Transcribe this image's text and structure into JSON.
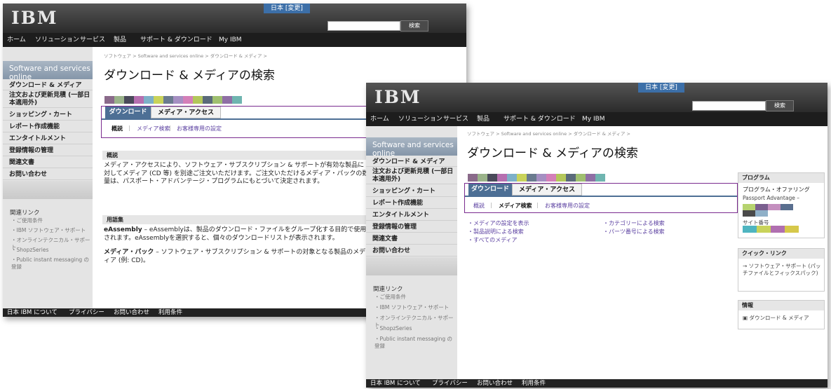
{
  "common": {
    "logo": "IBM",
    "country": "日本 [変更]",
    "search_button": "検索",
    "nav": [
      "ホーム",
      "ソリューション",
      "サービス",
      "製品",
      "サポート & ダウンロード",
      "My IBM"
    ],
    "side_header": "Software and services online",
    "side_items": [
      "ダウンロード & メディア",
      "注文および更新見積 (一部日本適用外)",
      "ショッピング・カート",
      "レポート作成機能",
      "エンタイトルメント",
      "登録情報の管理",
      "関連文書",
      "お問い合わせ"
    ],
    "related_title": "関連リンク",
    "related_items": [
      "ご使用条件",
      "IBM ソフトウェア・サポート",
      "オンラインテクニカル・サポート",
      "ShopzSeries",
      "Public instant messaging の登録"
    ],
    "breadcrumb": "ソフトウェア > Software and services online > ダウンロード & メディア >",
    "page_title": "ダウンロード & メディアの検索",
    "tab_download": "ダウンロード",
    "tab_media": "メディア・アクセス",
    "subtabs": [
      "概説",
      "メディア検索",
      "お客様専用の設定"
    ],
    "footer": [
      "日本 IBM について",
      "プライバシー",
      "お問い合わせ",
      "利用条件"
    ]
  },
  "screen1": {
    "section1_head": "概説",
    "section1_text": "メディア・アクセスにより、ソフトウェア・サブスクリプション & サポートが有効な製品に対してメディア (CD 等) を別途ご注文いただけます。ご注文いただけるメディア・パックの数量は、パスポート・アドバンテージ・プログラムにもとづいて決定されます。",
    "section2_head": "用語集",
    "glossary1_term": "eAssembly",
    "glossary1_text": " – eAssemblyは、製品のダウンロード・ファイルをグループ化する目的で使用されます。eAssemblyを選択すると、個々のダウンロードリストが表示されます。",
    "glossary2_term": "メディア・パック",
    "glossary2_text": " – ソフトウェア・サブスクリプション & サポートの対象となる製品のメディア (例: CD)。"
  },
  "screen2": {
    "links_left": [
      "メディアの設定を表示",
      "製品説明による検索",
      "すべてのメディア"
    ],
    "links_right": [
      "カテゴリーによる検索",
      "パーツ番号による検索"
    ],
    "program_head": "プログラム",
    "program_label": "プログラム・オファリング",
    "program_value": "Passport Advantage",
    "site_label": "サイト番号",
    "quick_head": "クイック・リンク",
    "quick_link": "ソフトウェア・サポート (パッチファイルとフィックスパック)",
    "info_head": "情報",
    "info_link": "ダウンロード & メディア"
  }
}
